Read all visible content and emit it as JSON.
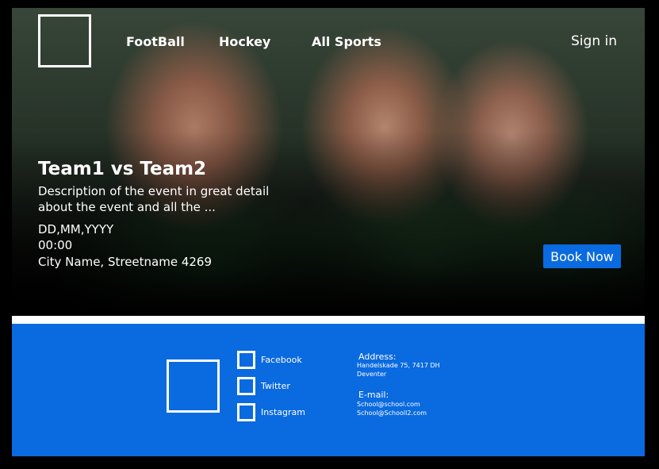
{
  "nav": {
    "items": [
      {
        "label": "FootBall"
      },
      {
        "label": "Hockey"
      },
      {
        "label": "All Sports"
      }
    ],
    "signin_label": "Sign in"
  },
  "event": {
    "title": "Team1 vs Team2",
    "description": "Description of the event in great detail about the event and all the ...",
    "date": "DD,MM,YYYY",
    "time": "00:00",
    "location": "City Name, Streetname 4269",
    "book_label": "Book Now"
  },
  "footer": {
    "social": [
      {
        "label": "Facebook"
      },
      {
        "label": "Twitter"
      },
      {
        "label": "Instagram"
      }
    ],
    "address_heading": "Address:",
    "address_lines": [
      "Handelskade 75, 7417 DH",
      "Deventer"
    ],
    "email_heading": "E-mail:",
    "email_lines": [
      "School@school.com",
      "School@Schooll2.com"
    ]
  },
  "colors": {
    "accent": "#0a6ae0",
    "background": "#000000",
    "text": "#ffffff"
  }
}
